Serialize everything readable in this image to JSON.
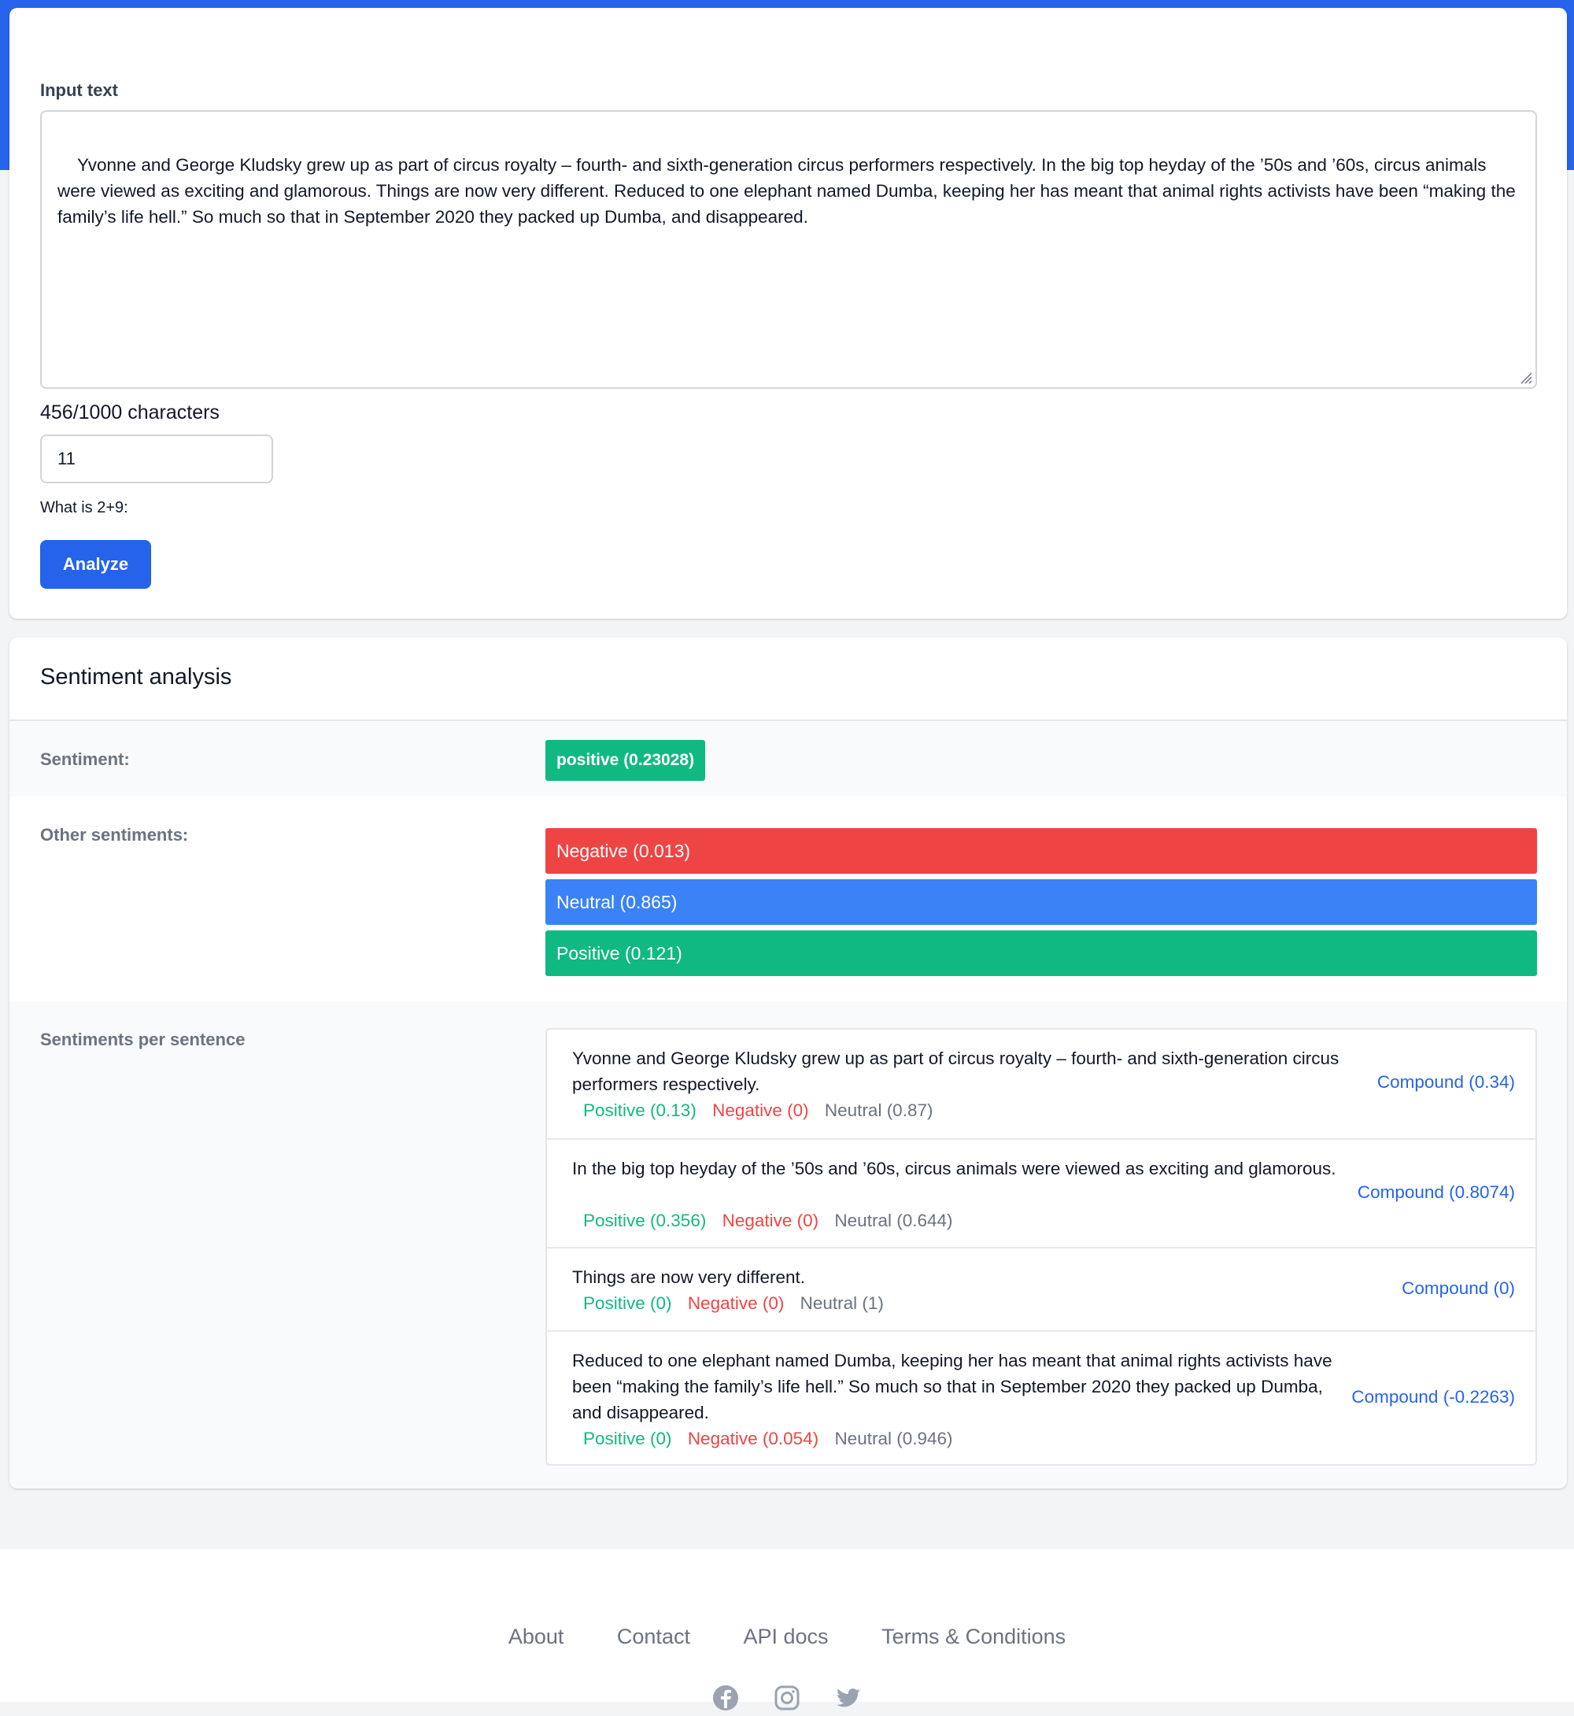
{
  "input": {
    "label": "Input text",
    "text": "Yvonne and George Kludsky grew up as part of circus royalty – fourth- and sixth-generation circus performers respectively. In the big top heyday of the ’50s and ’60s, circus animals were viewed as exciting and glamorous. Things are now very different. Reduced to one elephant named Dumba, keeping her has meant that animal rights activists have been “making the family’s life hell.” So much so that in September 2020 they packed up Dumba, and disappeared.",
    "char_count": "456/1000 characters",
    "captcha_value": "11",
    "captcha_label": "What is 2+9:",
    "analyze_label": "Analyze"
  },
  "results": {
    "title": "Sentiment analysis",
    "sentiment_label": "Sentiment:",
    "sentiment_value": "positive (0.23028)",
    "other_label": "Other sentiments:",
    "other": [
      {
        "label": "Negative (0.013)",
        "color": "#ef4444"
      },
      {
        "label": "Neutral (0.865)",
        "color": "#3b82f6"
      },
      {
        "label": "Positive (0.121)",
        "color": "#10b981"
      }
    ],
    "per_sentence_label": "Sentiments per sentence",
    "sentences": [
      {
        "text": "Yvonne and George Kludsky grew up as part of circus royalty – fourth- and sixth-generation circus performers respectively.",
        "positive": "Positive (0.13)",
        "negative": "Negative (0)",
        "neutral": "Neutral (0.87)",
        "compound": "Compound (0.34)"
      },
      {
        "text": "In the big top heyday of the ’50s and ’60s, circus animals were viewed as exciting and glamorous.",
        "positive": "Positive (0.356)",
        "negative": "Negative (0)",
        "neutral": "Neutral (0.644)",
        "compound": "Compound (0.8074)"
      },
      {
        "text": "Things are now very different.",
        "positive": "Positive (0)",
        "negative": "Negative (0)",
        "neutral": "Neutral (1)",
        "compound": "Compound (0)"
      },
      {
        "text": "Reduced to one elephant named Dumba, keeping her has meant that animal rights activists have been “making the family’s life hell.” So much so that in September 2020 they packed up Dumba, and disappeared.",
        "positive": "Positive (0)",
        "negative": "Negative (0.054)",
        "neutral": "Neutral (0.946)",
        "compound": "Compound (-0.2263)"
      }
    ]
  },
  "footer": {
    "links": [
      "About",
      "Contact",
      "API docs",
      "Terms & Conditions"
    ],
    "social_icons": [
      "facebook-icon",
      "instagram-icon",
      "twitter-icon"
    ]
  },
  "colors": {
    "accent": "#2563eb",
    "positive": "#10b981",
    "negative": "#ef4444",
    "neutral": "#3b82f6"
  }
}
